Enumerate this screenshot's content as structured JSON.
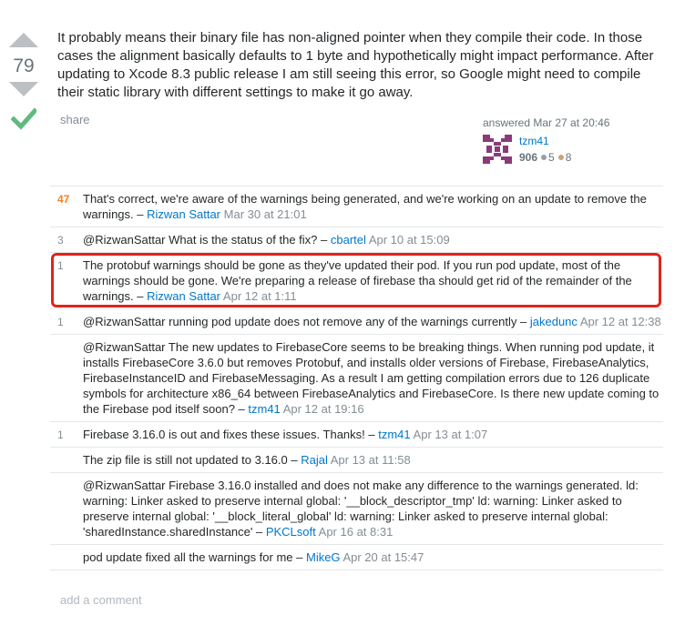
{
  "answer": {
    "vote_count": "79",
    "body": "It probably means their binary file has non-aligned pointer when they compile their code. In those cases the alignment basically defaults to 1 byte and hypothetically might impact performance. After updating to Xcode 8.3 public release I am still seeing this error, so Google might need to compile their static library with different settings to make it go away.",
    "share_label": "share",
    "answered_text": "answered Mar 27 at 20:46",
    "user": {
      "name": "tzm41",
      "reputation": "906",
      "silver_badges": "5",
      "bronze_badges": "8"
    }
  },
  "comments": [
    {
      "score": "47",
      "text": "That's correct, we're aware of the warnings being generated, and we're working on an update to remove the warnings. – ",
      "user": "Rizwan Sattar",
      "date": "Mar 30 at 21:01"
    },
    {
      "score": "3",
      "text": "@RizwanSattar What is the status of the fix? – ",
      "user": "cbartel",
      "date": "Apr 10 at 15:09"
    },
    {
      "score": "1",
      "text": "The protobuf warnings should be gone as they've updated their pod. If you run pod update, most of the warnings should be gone. We're preparing a release of firebase tha should get rid of the remainder of the warnings. – ",
      "user": "Rizwan Sattar",
      "date": "Apr 12 at 1:11"
    },
    {
      "score": "1",
      "text": "@RizwanSattar running pod update does not remove any of the warnings currently – ",
      "user": "jakedunc",
      "date": "Apr 12 at 12:38"
    },
    {
      "score": "",
      "text": "@RizwanSattar The new updates to FirebaseCore seems to be breaking things. When running pod update, it installs FirebaseCore 3.6.0 but removes Protobuf, and installs older versions of Firebase, FirebaseAnalytics, FirebaseInstanceID and FirebaseMessaging. As a result I am getting compilation errors due to 126 duplicate symbols for architecture x86_64 between FirebaseAnalytics and FirebaseCore. Is there new update coming to the Firebase pod itself soon? – ",
      "user": "tzm41",
      "date": "Apr 12 at 19:16"
    },
    {
      "score": "1",
      "text": "Firebase 3.16.0 is out and fixes these issues. Thanks! – ",
      "user": "tzm41",
      "date": "Apr 13 at 1:07"
    },
    {
      "score": "",
      "text": "The zip file is still not updated to 3.16.0 – ",
      "user": "Rajal",
      "date": "Apr 13 at 11:58"
    },
    {
      "score": "",
      "text": "@RizwanSattar Firebase 3.16.0 installed and does not make any difference to the warnings generated. ld: warning: Linker asked to preserve internal global: '__block_descriptor_tmp' ld: warning: Linker asked to preserve internal global: '__block_literal_global' ld: warning: Linker asked to preserve internal global: 'sharedInstance.sharedInstance' – ",
      "user": "PKCLsoft",
      "date": "Apr 16 at 8:31"
    },
    {
      "score": "",
      "text": "pod update fixed all the warnings for me – ",
      "user": "MikeG",
      "date": "Apr 20 at 15:47"
    }
  ],
  "add_comment_label": "add a comment",
  "colors": {
    "link": "#0077cc",
    "muted": "#848d95",
    "hot_score": "#f48024",
    "accepted_check": "#5eba7d",
    "highlight_box": "#e2231a",
    "silver_badge": "#9a9fa6",
    "bronze_badge": "#c9a37c"
  }
}
